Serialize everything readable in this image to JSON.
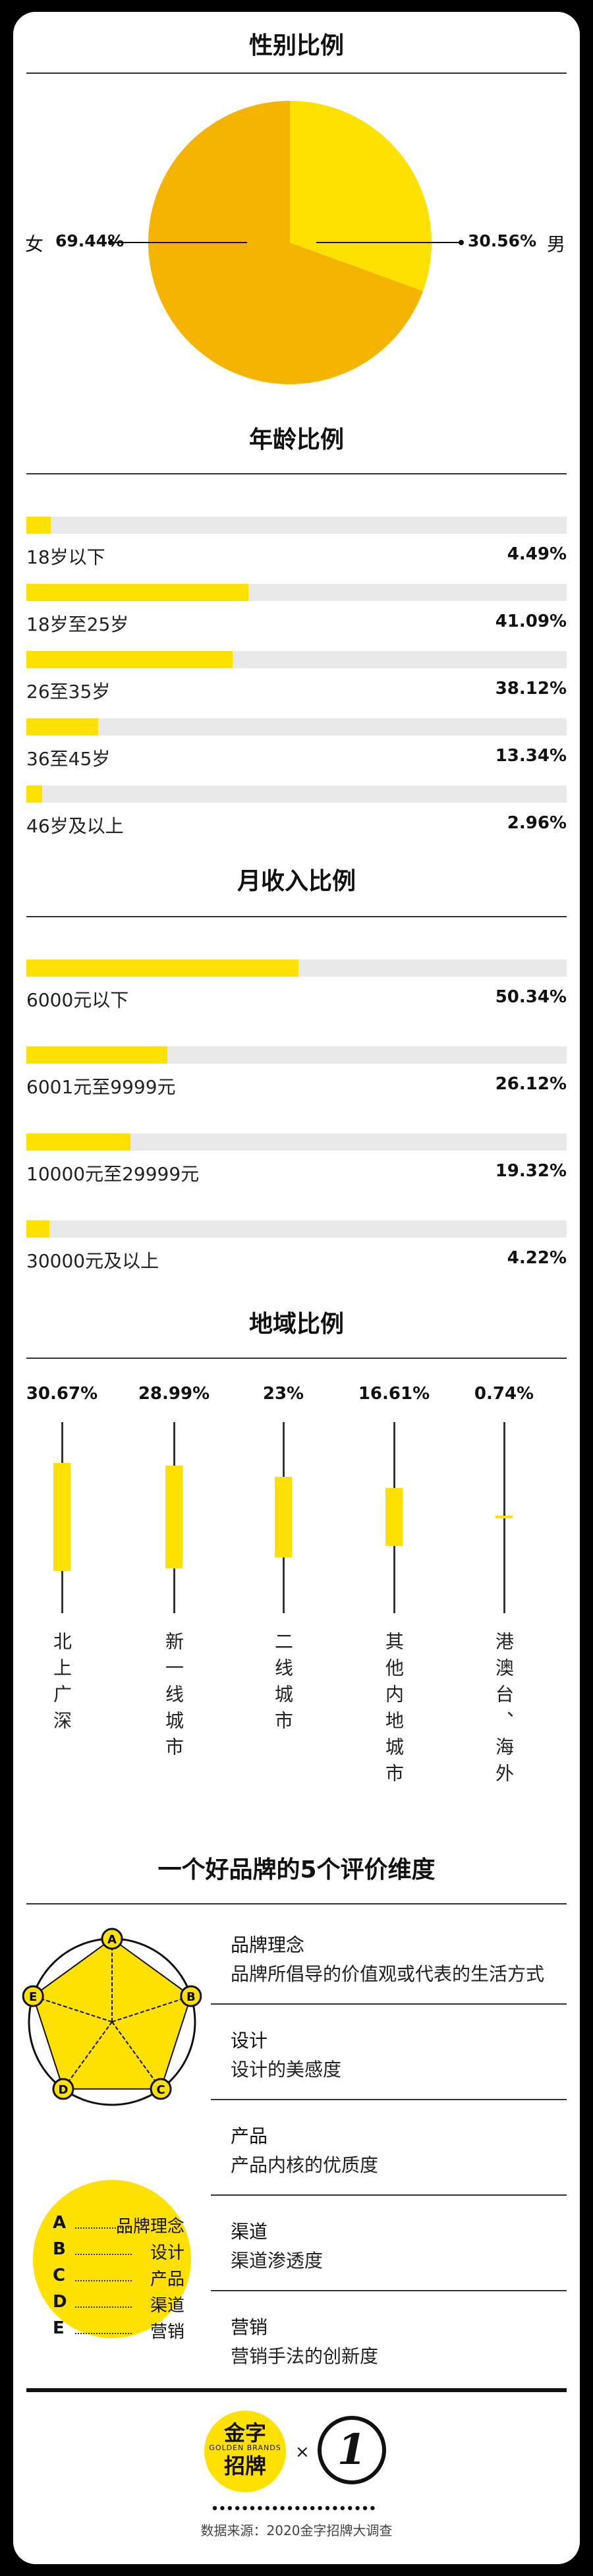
{
  "gender": {
    "title": "性别比例",
    "female_label": "女",
    "female_value": "69.44%",
    "male_value": "30.56%",
    "male_label": "男",
    "colors": {
      "female": "#f5b400",
      "male": "#ffe100"
    }
  },
  "age": {
    "title": "年龄比例",
    "rows": [
      {
        "label": "18岁以下",
        "value": "4.49%",
        "pct": 4.49
      },
      {
        "label": "18岁至25岁",
        "value": "41.09%",
        "pct": 41.09
      },
      {
        "label": "26至35岁",
        "value": "38.12%",
        "pct": 38.12
      },
      {
        "label": "36至45岁",
        "value": "13.34%",
        "pct": 13.34
      },
      {
        "label": "46岁及以上",
        "value": "2.96%",
        "pct": 2.96
      }
    ]
  },
  "income": {
    "title": "月收入比例",
    "rows": [
      {
        "label": "6000元以下",
        "value": "50.34%",
        "pct": 50.34
      },
      {
        "label": "6001元至9999元",
        "value": "26.12%",
        "pct": 26.12
      },
      {
        "label": "10000元至29999元",
        "value": "19.32%",
        "pct": 19.32
      },
      {
        "label": "30000元及以上",
        "value": "4.22%",
        "pct": 4.22
      }
    ]
  },
  "region": {
    "title": "地域比例",
    "columns": [
      {
        "value": "30.67%",
        "pct": 30.67,
        "label": "北上广深"
      },
      {
        "value": "28.99%",
        "pct": 28.99,
        "label": "新一线城市"
      },
      {
        "value": "23%",
        "pct": 23,
        "label": "二线城市"
      },
      {
        "value": "16.61%",
        "pct": 16.61,
        "label": "其他内地城市"
      },
      {
        "value": "0.74%",
        "pct": 0.74,
        "label": "港澳台、海外"
      }
    ]
  },
  "dimensions": {
    "title": "一个好品牌的5个评价维度",
    "items": [
      {
        "name": "品牌理念",
        "desc": "品牌所倡导的价值观或代表的生活方式"
      },
      {
        "name": "设计",
        "desc": "设计的美感度"
      },
      {
        "name": "产品",
        "desc": "产品内核的优质度"
      },
      {
        "name": "渠道",
        "desc": "渠道渗透度"
      },
      {
        "name": "营销",
        "desc": "营销手法的创新度"
      }
    ],
    "radar_letters": [
      "A",
      "B",
      "C",
      "D",
      "E"
    ],
    "legend": [
      {
        "key": "A",
        "label": "品牌理念"
      },
      {
        "key": "B",
        "label": "设计"
      },
      {
        "key": "C",
        "label": "产品"
      },
      {
        "key": "D",
        "label": "渠道"
      },
      {
        "key": "E",
        "label": "营销"
      }
    ]
  },
  "footer": {
    "logo_line1": "金字",
    "logo_line2": "招牌",
    "logo_sub": "GOLDEN BRANDS",
    "times": "×",
    "partner_glyph": "1",
    "source": "数据来源：2020金字招牌大调查"
  },
  "colors": {
    "accent": "#ffe100",
    "track": "#e8e8e8",
    "ink": "#111111"
  }
}
